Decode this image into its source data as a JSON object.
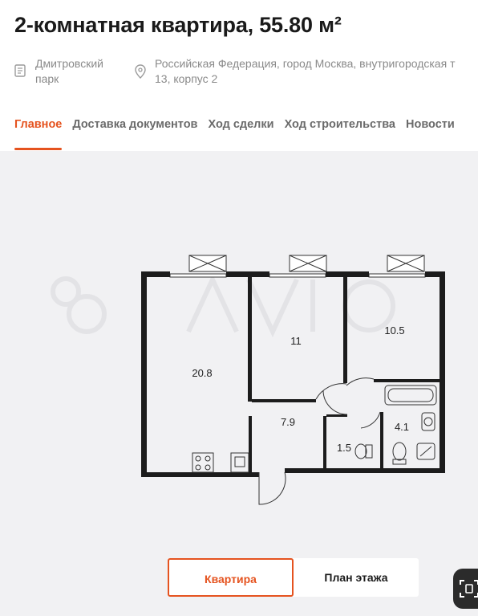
{
  "listing": {
    "title": "2-комнатная квартира, 55.80 м²",
    "park": "Дмитровский парк",
    "address_line1": "Российская Федерация, город Москва, внутригородская т",
    "address_line2": "13, корпус 2"
  },
  "tabs": [
    {
      "label": "Главное",
      "active": true
    },
    {
      "label": "Доставка документов",
      "active": false
    },
    {
      "label": "Ход сделки",
      "active": false
    },
    {
      "label": "Ход строительства",
      "active": false
    },
    {
      "label": "Новости",
      "active": false
    }
  ],
  "floorplan": {
    "rooms": {
      "living": "20.8",
      "bedroom1": "11",
      "bedroom2": "10.5",
      "hall": "7.9",
      "wc": "1.5",
      "bath": "4.1"
    }
  },
  "switcher": {
    "apartment": "Квартира",
    "floor_plan": "План этажа"
  },
  "colors": {
    "accent": "#e5531f",
    "text": "#1a1a1a",
    "muted": "#8a8a8a",
    "plan_bg": "#f1f1f3"
  },
  "icons": [
    "document-icon",
    "location-pin-icon",
    "scan-icon"
  ]
}
